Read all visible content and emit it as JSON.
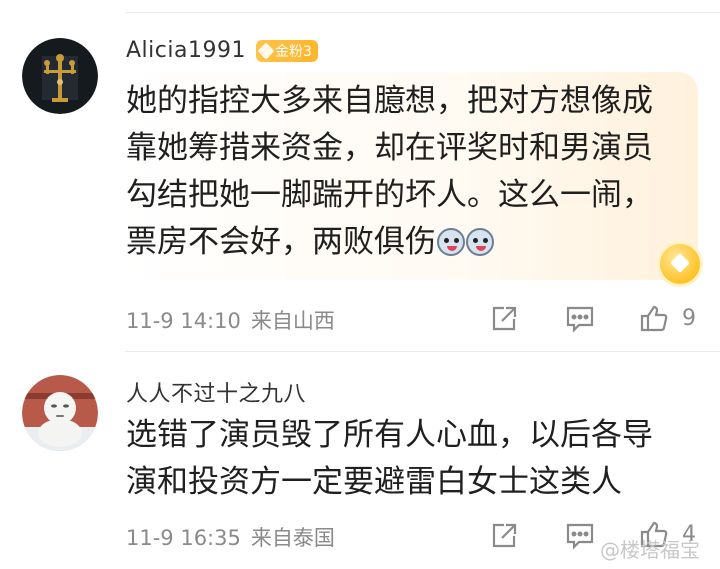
{
  "comments": [
    {
      "username": "Alicia1991",
      "badge": "金粉3",
      "lines": [
        "她的指控大多来自臆想，把对方想像成",
        "靠她筹措来资金，却在评奖时和男演员",
        "勾结把她一脚踹开的坏人。这么一闹，",
        "票房不会好，两败俱伤"
      ],
      "time": "11-9 14:10",
      "location": "来自山西",
      "likes": "9"
    },
    {
      "username": "人人不过十之九八",
      "lines": [
        "选错了演员毁了所有人心血，以后各导",
        "演和投资方一定要避雷白女士这类人"
      ],
      "time": "11-9 16:35",
      "location": "来自泰国",
      "likes": "4"
    }
  ],
  "watermark": "@楼塔福宝",
  "icons": [
    "share-icon",
    "comment-icon",
    "like-icon"
  ],
  "colors": {
    "badge": "#ffb629",
    "meta": "#8a8a8a",
    "text": "#1f1f1f"
  }
}
